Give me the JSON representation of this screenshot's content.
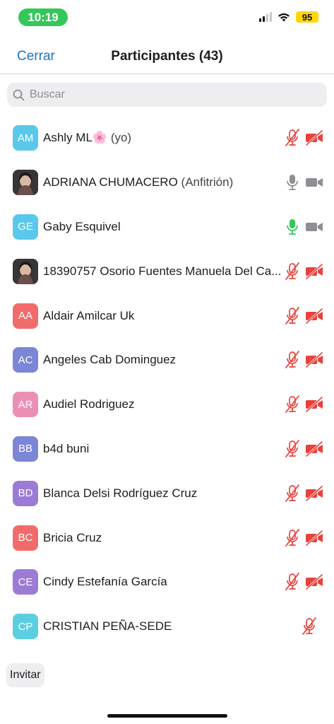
{
  "status_bar": {
    "time": "10:19",
    "battery": "95",
    "colors": {
      "time_pill": "#34c759",
      "battery": "#ffd60a"
    }
  },
  "nav": {
    "close_label": "Cerrar",
    "title": "Participantes (43)"
  },
  "search": {
    "placeholder": "Buscar"
  },
  "colors": {
    "accent": "#1a73c9",
    "muted_red": "#e8413b",
    "gray_icon": "#8e8e93",
    "speaking_green": "#34c759"
  },
  "participants": [
    {
      "initials": "AM",
      "avatar_color": "#5ac8ea",
      "name": "Ashly ML🌸",
      "suffix": "(yo)",
      "mic": "muted",
      "cam": "off"
    },
    {
      "initials": "",
      "avatar": "photo",
      "name": "ADRIANA CHUMACERO",
      "suffix": "(Anfitrión)",
      "mic": "on",
      "cam": "on"
    },
    {
      "initials": "GE",
      "avatar_color": "#5ac8ea",
      "name": "Gaby Esquivel",
      "suffix": "",
      "mic": "speaking",
      "cam": "on"
    },
    {
      "initials": "",
      "avatar": "photo",
      "name": "18390757 Osorio Fuentes Manuela Del Ca...",
      "suffix": "",
      "mic": "muted",
      "cam": "off"
    },
    {
      "initials": "AA",
      "avatar_color": "#f26b6b",
      "name": "Aldair Amilcar Uk",
      "suffix": "",
      "mic": "muted",
      "cam": "off"
    },
    {
      "initials": "AC",
      "avatar_color": "#7b86d6",
      "name": "Angeles Cab Dominguez",
      "suffix": "",
      "mic": "muted",
      "cam": "off"
    },
    {
      "initials": "AR",
      "avatar_color": "#ec8fb6",
      "name": "Audiel Rodriguez",
      "suffix": "",
      "mic": "muted",
      "cam": "off"
    },
    {
      "initials": "BB",
      "avatar_color": "#7b86d6",
      "name": "b4d buni",
      "suffix": "",
      "mic": "muted",
      "cam": "off"
    },
    {
      "initials": "BD",
      "avatar_color": "#9c7bd6",
      "name": "Blanca Delsi Rodríguez Cruz",
      "suffix": "",
      "mic": "muted",
      "cam": "off"
    },
    {
      "initials": "BC",
      "avatar_color": "#f26b6b",
      "name": "Bricia Cruz",
      "suffix": "",
      "mic": "muted",
      "cam": "off"
    },
    {
      "initials": "CE",
      "avatar_color": "#9c7bd6",
      "name": "Cindy Estefanía García",
      "suffix": "",
      "mic": "muted",
      "cam": "off"
    },
    {
      "initials": "CP",
      "avatar_color": "#5bcfe0",
      "name": "CRISTIAN PEÑA-SEDE",
      "suffix": "",
      "mic": "muted",
      "cam": "none"
    }
  ],
  "footer": {
    "invite_label": "Invitar"
  }
}
